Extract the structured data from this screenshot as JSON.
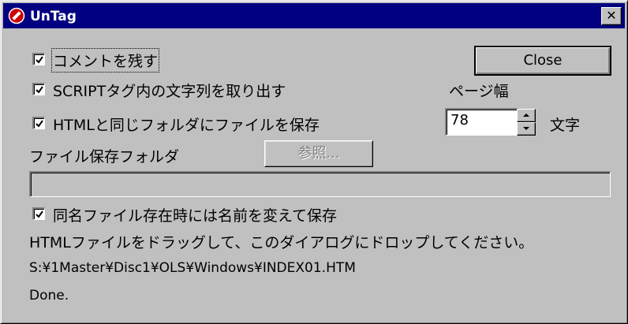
{
  "window": {
    "title": "UnTag",
    "close_glyph": "✕",
    "app_icon": "no-entry-icon"
  },
  "options": {
    "keep_comments": {
      "label": "コメントを残す",
      "checked": true
    },
    "extract_script": {
      "label": "SCRIPTタグ内の文字列を取り出す",
      "checked": true
    },
    "save_same_folder": {
      "label": "HTMLと同じフォルダにファイルを保存",
      "checked": true
    },
    "rename_if_exists": {
      "label": "同名ファイル存在時には名前を変えて保存",
      "checked": true
    }
  },
  "buttons": {
    "close": "Close",
    "browse": "参照..."
  },
  "page_width": {
    "label": "ページ幅",
    "value": "78",
    "unit": "文字"
  },
  "save_folder": {
    "label": "ファイル保存フォルダ",
    "value": ""
  },
  "instructions": "HTMLファイルをドラッグして、このダイアログにドロップしてください。",
  "file_path": "S:¥1Master¥Disc1¥OLS¥Windows¥INDEX01.HTM",
  "status": "Done.",
  "colors": {
    "title_bar": "#000080",
    "face": "#c0c0c0",
    "icon_red": "#cc0000"
  }
}
